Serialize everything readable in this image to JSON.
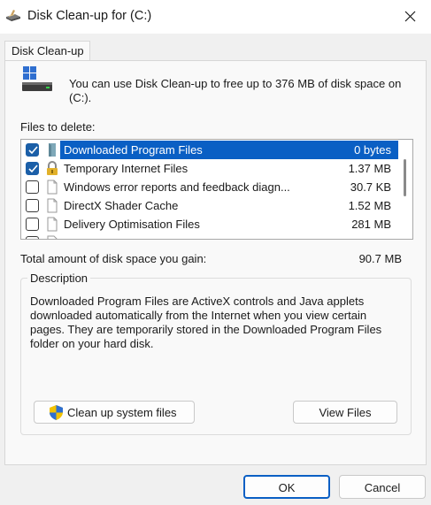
{
  "window": {
    "title": "Disk Clean-up for  (C:)"
  },
  "tab": {
    "label": "Disk Clean-up"
  },
  "intro": {
    "text": "You can use Disk Clean-up to free up to 376 MB of disk space on (C:)."
  },
  "files": {
    "label": "Files to delete:",
    "items": [
      {
        "name": "Downloaded Program Files",
        "size": "0 bytes",
        "checked": true,
        "selected": true,
        "icon": "package-icon"
      },
      {
        "name": "Temporary Internet Files",
        "size": "1.37 MB",
        "checked": true,
        "selected": false,
        "icon": "lock-icon"
      },
      {
        "name": "Windows error reports and feedback diagn...",
        "size": "30.7 KB",
        "checked": false,
        "selected": false,
        "icon": "document-icon"
      },
      {
        "name": "DirectX Shader Cache",
        "size": "1.52 MB",
        "checked": false,
        "selected": false,
        "icon": "document-icon"
      },
      {
        "name": "Delivery Optimisation Files",
        "size": "281 MB",
        "checked": false,
        "selected": false,
        "icon": "document-icon"
      }
    ]
  },
  "total": {
    "label": "Total amount of disk space you gain:",
    "value": "90.7 MB"
  },
  "description": {
    "legend": "Description",
    "text": "Downloaded Program Files are ActiveX controls and Java applets downloaded automatically from the Internet when you view certain pages. They are temporarily stored in the Downloaded Program Files folder on your hard disk."
  },
  "buttons": {
    "cleanup": "Clean up system files",
    "view_files": "View Files",
    "ok": "OK",
    "cancel": "Cancel"
  },
  "colors": {
    "selection": "#0a5fc4",
    "checkbox": "#1b5fa8",
    "shield_blue": "#2f6fd0",
    "shield_yellow": "#f2c200"
  }
}
